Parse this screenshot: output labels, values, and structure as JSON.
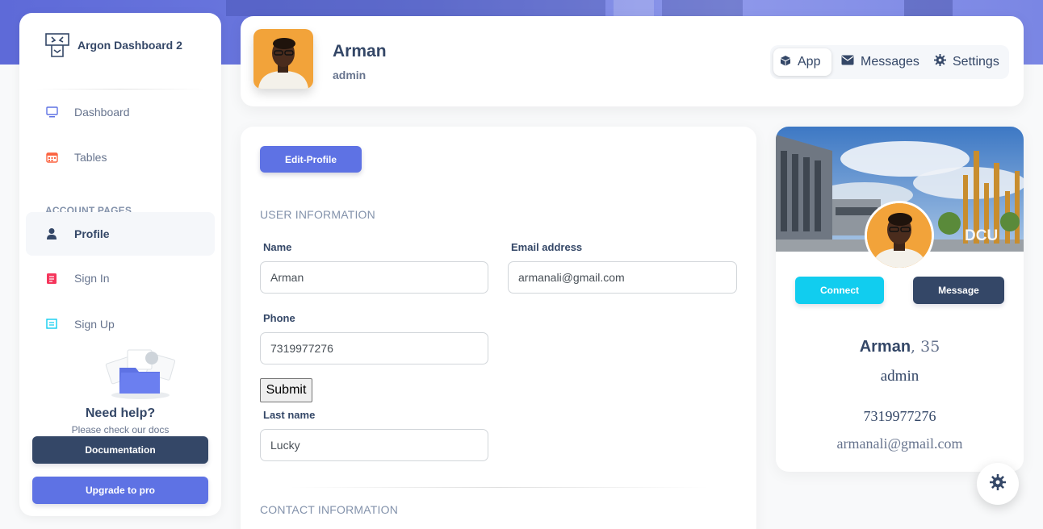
{
  "brand": {
    "name": "Argon Dashboard 2",
    "logo_icon": "box-logo-icon"
  },
  "sidebar": {
    "items": [
      {
        "label": "Dashboard",
        "icon": "tv-icon",
        "color": "#5e72e4"
      },
      {
        "label": "Tables",
        "icon": "calendar-grid-icon",
        "color": "#fb6340"
      },
      {
        "label": "Profile",
        "icon": "user-icon",
        "color": "#344767",
        "active": true
      },
      {
        "label": "Sign In",
        "icon": "document-icon",
        "color": "#f5365c"
      },
      {
        "label": "Sign Up",
        "icon": "collection-icon",
        "color": "#11cdef"
      }
    ],
    "section_label": "ACCOUNT PAGES",
    "help": {
      "title": "Need help?",
      "subtitle": "Please check our docs",
      "documentation_label": "Documentation",
      "upgrade_label": "Upgrade to pro"
    }
  },
  "header": {
    "name": "Arman",
    "role": "admin",
    "tabs": [
      {
        "label": "App",
        "icon": "cube-icon",
        "active": true
      },
      {
        "label": "Messages",
        "icon": "envelope-icon"
      },
      {
        "label": "Settings",
        "icon": "gear-icon"
      }
    ]
  },
  "form": {
    "edit_button": "Edit-Profile",
    "user_info_heading": "USER INFORMATION",
    "name_label": "Name",
    "name_value": "Arman",
    "email_label": "Email address",
    "email_value": "armanali@gmail.com",
    "phone_label": "Phone",
    "phone_value": "7319977276",
    "submit_label": "Submit",
    "lastname_label": "Last name",
    "lastname_value": "Lucky",
    "contact_heading": "CONTACT INFORMATION"
  },
  "profile_card": {
    "cover_text": "DCU",
    "connect_label": "Connect",
    "message_label": "Message",
    "name": "Arman",
    "age": ", 35",
    "role": "admin",
    "phone": "7319977276",
    "email": "armanali@gmail.com"
  },
  "colors": {
    "primary": "#5e72e4",
    "dark": "#344767",
    "info": "#11cdef",
    "muted": "#67748e"
  }
}
